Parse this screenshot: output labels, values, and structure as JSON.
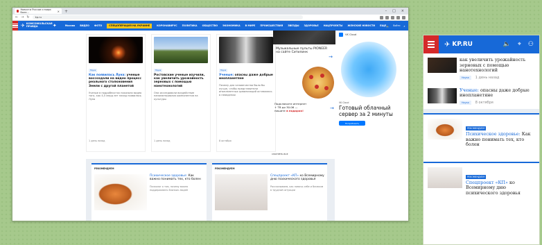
{
  "browser": {
    "tab_title": "Новости России и мира: боле...",
    "url": "kp.ru"
  },
  "site": {
    "logo_text": "КОМСОМОЛЬСКАЯ ПРАВДА",
    "mobile_logo_text": "KP.RU",
    "nav": [
      "Москва",
      "ВИДЕО",
      "ФОТО",
      "СПЕЦОПЕРАЦИЯ НА УКРАИНЕ",
      "КОРОНАВИРУС",
      "ПОЛИТИКА",
      "ОБЩЕСТВО",
      "ЭКОНОМИКА",
      "В МИРЕ",
      "ПРОИСШЕСТВИЯ",
      "ЗВЕЗДЫ",
      "ЗДОРОВЬЕ",
      "НАЦПРОЕКТЫ",
      "ЖЕНСКИЕ НОВОСТИ",
      "ЕЩЕ"
    ],
    "login": "Войти"
  },
  "cards": [
    {
      "badge": "Наука",
      "title_blue": "Как появилась Луна:",
      "title": " ученые воссоздали на видео процесс реального столкновения Земли с другой планетой",
      "sub": "Ученые в подробностях показали видео того, как 4,5 млрд лет назад появилась Луна",
      "date": "1 день назад"
    },
    {
      "badge": "Наука",
      "title_blue": "",
      "title": "Ростовские ученые изучили, как увеличить урожайность зерновых с помощью нанотехнологий",
      "sub": "Они исследовали воздействие наноматериалов компонентов на культуры",
      "date": "1 день назад"
    },
    {
      "badge": "Наука",
      "title_blue": "Ученые:",
      "title": " опасны даже добрые инопланетяне",
      "sub": "Почему для человечества было бы лучше, чтобы представители инопланетных цивилизаций оставались в неведении",
      "date": "8 октября"
    }
  ],
  "sidebar": {
    "top_title": "Музыкальные пульты PIONEER на сайте Ситилинк",
    "bottom_title": "Подключите интернет + ТВ до 30.06 — пишите",
    "bottom_tail": "в подарок!",
    "see_all": "СМОТРЕТЬ ВСЕ"
  },
  "ad": {
    "brand": "VK Cloud",
    "sponsor": "VK Cloud",
    "title": "Готовый облачный сервер за 2 минуты",
    "button": "Попробовать"
  },
  "recommended": {
    "header": "РЕКОМЕНДУЕМ",
    "items": [
      {
        "title_blue": "Психическое здоровье:",
        "title": " Как важно понимать тех, кто болен",
        "sub": "Психолог о том, почему важно поддерживать близких людей"
      },
      {
        "title_blue": "Спецпроект «КП»",
        "title": " ко Всемирному дню психического здоровья",
        "sub": "Рассказываем, как помочь себе и близким в трудной ситуации"
      }
    ]
  },
  "mobile": {
    "items": [
      {
        "title": "как увеличить урожайность зерновых с помощью нанотехнологий",
        "badge": "Наука",
        "date": "1 день назад"
      },
      {
        "title_blue": "Ученые:",
        "title": " опасны даже добрые инопланетяне",
        "badge": "Наука",
        "date": "8 октября"
      }
    ],
    "recs": [
      {
        "badge": "РЕКОМЕНДУЕМ",
        "title_blue": "Психическое здоровье:",
        "title": " Как важно понимать тех, кто болен"
      },
      {
        "badge": "РЕКОМЕНДУЕМ",
        "title_blue": "Спецпроект «КП»",
        "title": " ко Всемирному дню психического здоровья"
      }
    ]
  }
}
